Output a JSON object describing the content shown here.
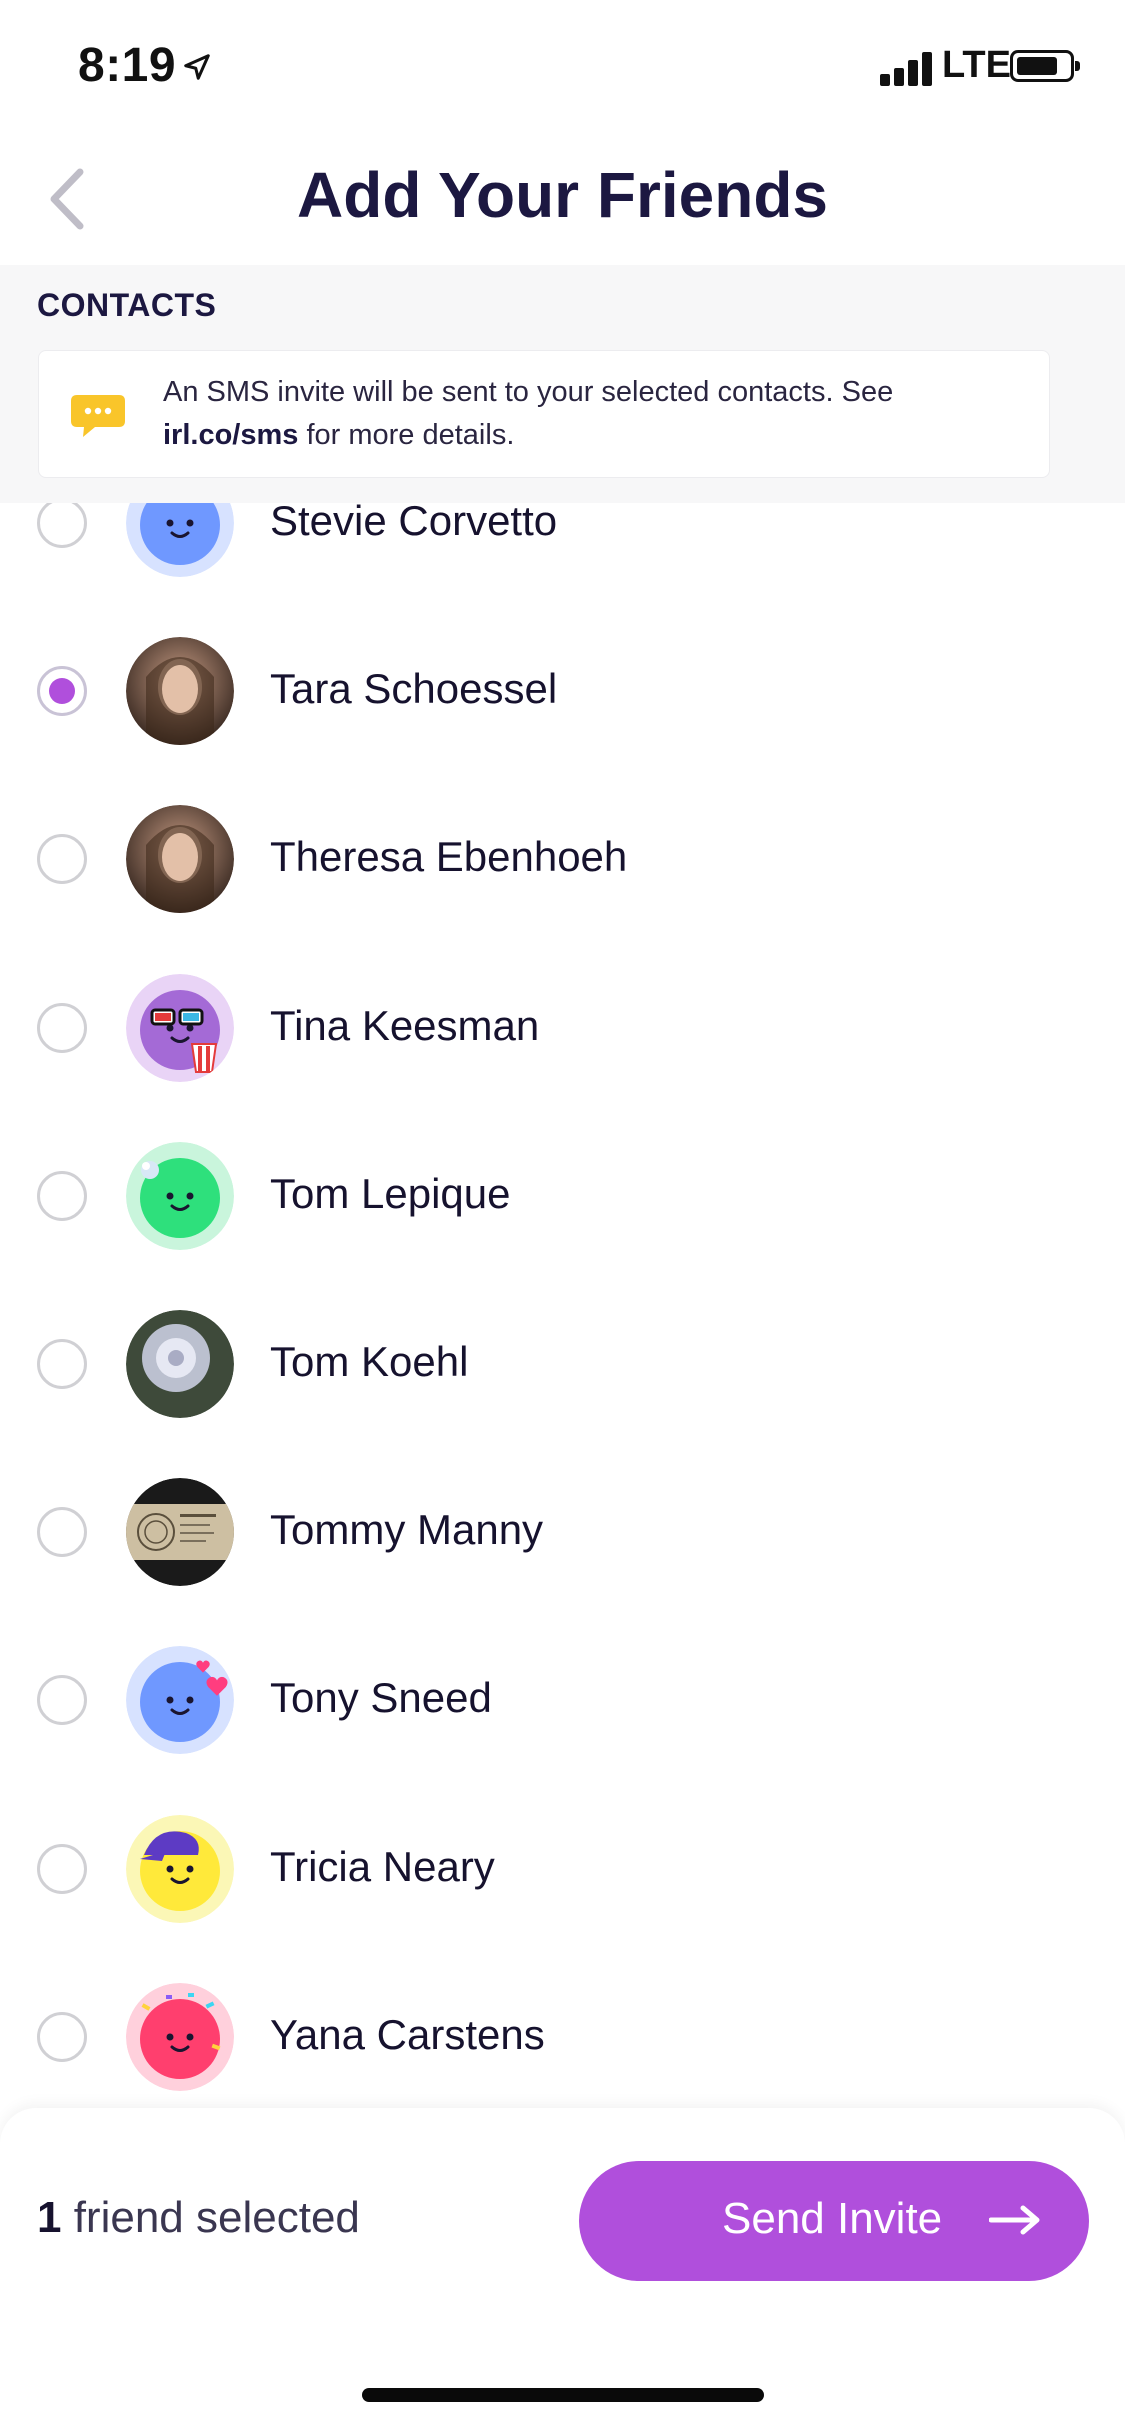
{
  "status_bar": {
    "time": "8:19",
    "network": "LTE"
  },
  "header": {
    "title": "Add Your Friends",
    "back_icon": "chevron-left-icon"
  },
  "contacts": {
    "label": "CONTACTS",
    "info_text_before": "An SMS invite will be sent to your selected contacts. See ",
    "info_link": "irl.co/sms",
    "info_text_after": " for more details."
  },
  "colors": {
    "accent": "#b04fdc",
    "title": "#1c1841",
    "radio_border": "#d0d0d4"
  },
  "friends": [
    {
      "name": "Stevie Corvetto",
      "selected": false,
      "avatar": "blue-smiley-heart"
    },
    {
      "name": "Tara Schoessel",
      "selected": true,
      "avatar": "photo"
    },
    {
      "name": "Theresa Ebenhoeh",
      "selected": false,
      "avatar": "photo"
    },
    {
      "name": "Tina Keesman",
      "selected": false,
      "avatar": "purple-3d-glasses-popcorn"
    },
    {
      "name": "Tom Lepique",
      "selected": false,
      "avatar": "green-smiley"
    },
    {
      "name": "Tom Koehl",
      "selected": false,
      "avatar": "photo-dandelion"
    },
    {
      "name": "Tommy Manny",
      "selected": false,
      "avatar": "photo-document"
    },
    {
      "name": "Tony Sneed",
      "selected": false,
      "avatar": "blue-smiley-hearts"
    },
    {
      "name": "Tricia Neary",
      "selected": false,
      "avatar": "yellow-smiley-cap"
    },
    {
      "name": "Yana Carstens",
      "selected": false,
      "avatar": "pink-smiley-confetti"
    }
  ],
  "footer": {
    "selected_count": "1",
    "selected_suffix": " friend selected",
    "send_label": "Send Invite",
    "send_icon": "arrow-right-icon"
  }
}
